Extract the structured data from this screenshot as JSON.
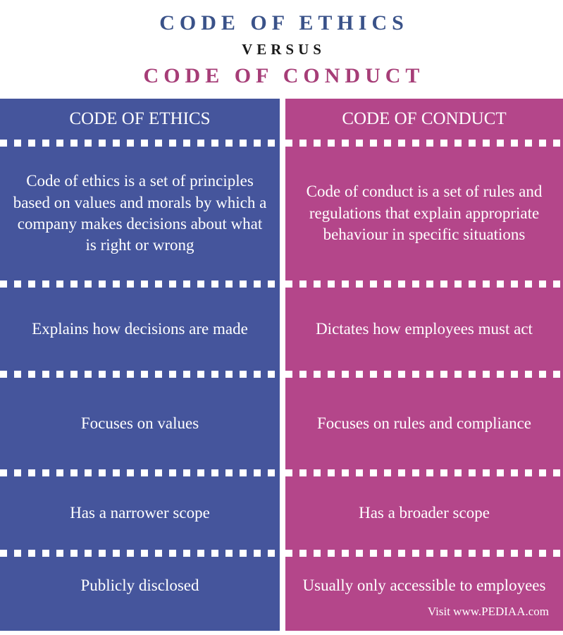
{
  "title": {
    "line1": "CODE OF ETHICS",
    "versus": "VERSUS",
    "line2": "CODE OF CONDUCT"
  },
  "colors": {
    "left_panel": "#45559C",
    "right_panel": "#B4468A",
    "title_left": "#3A5289",
    "title_right": "#A63D77",
    "versus": "#1A1A1A",
    "text": "#FFFFFF",
    "background": "#FFFFFF"
  },
  "columns": {
    "left_header": "CODE OF ETHICS",
    "right_header": "CODE OF CONDUCT"
  },
  "rows": [
    {
      "left": "Code of ethics is a set of principles based on values and morals by which a company makes decisions about what is right or wrong",
      "right": "Code of conduct is a set of rules and regulations that explain appropriate behaviour in specific situations"
    },
    {
      "left": "Explains how decisions are made",
      "right": "Dictates how employees must act"
    },
    {
      "left": "Focuses on values",
      "right": "Focuses on rules and compliance"
    },
    {
      "left": "Has a narrower scope",
      "right": "Has a broader scope"
    },
    {
      "left": "Publicly disclosed",
      "right": "Usually only accessible to employees"
    }
  ],
  "footer": {
    "attribution": "Visit www.PEDIAA.com"
  }
}
